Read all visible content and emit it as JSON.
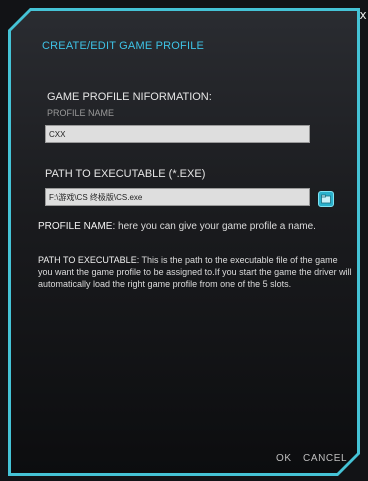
{
  "dialog": {
    "title": "CREATE/EDIT GAME PROFILE",
    "close_glyph": "x"
  },
  "profile_info": {
    "section_title": "GAME PROFILE NIFORMATION:",
    "name_label": "PROFILE NAME",
    "name_value": "CXX"
  },
  "executable": {
    "label": "PATH TO EXECUTABLE (*.EXE)",
    "path_value": "F:\\游戏\\CS 终极版\\CS.exe",
    "browse_icon": "folder-open-icon"
  },
  "help": {
    "profile_name_term": "PROFILE NAME:",
    "profile_name_text": " here you can give your game profile a name.",
    "path_term": "PATH TO EXECUTABLE:",
    "path_text": "  This is the path to the executable file of the game you want the game profile to be assigned to.If you start the game the driver will automatically load the right game profile from one of the 5 slots."
  },
  "buttons": {
    "ok": "OK",
    "cancel": "CANCEL"
  },
  "colors": {
    "accent": "#45c3d6",
    "title": "#3ec3e6",
    "background": "#1a1b1e"
  }
}
